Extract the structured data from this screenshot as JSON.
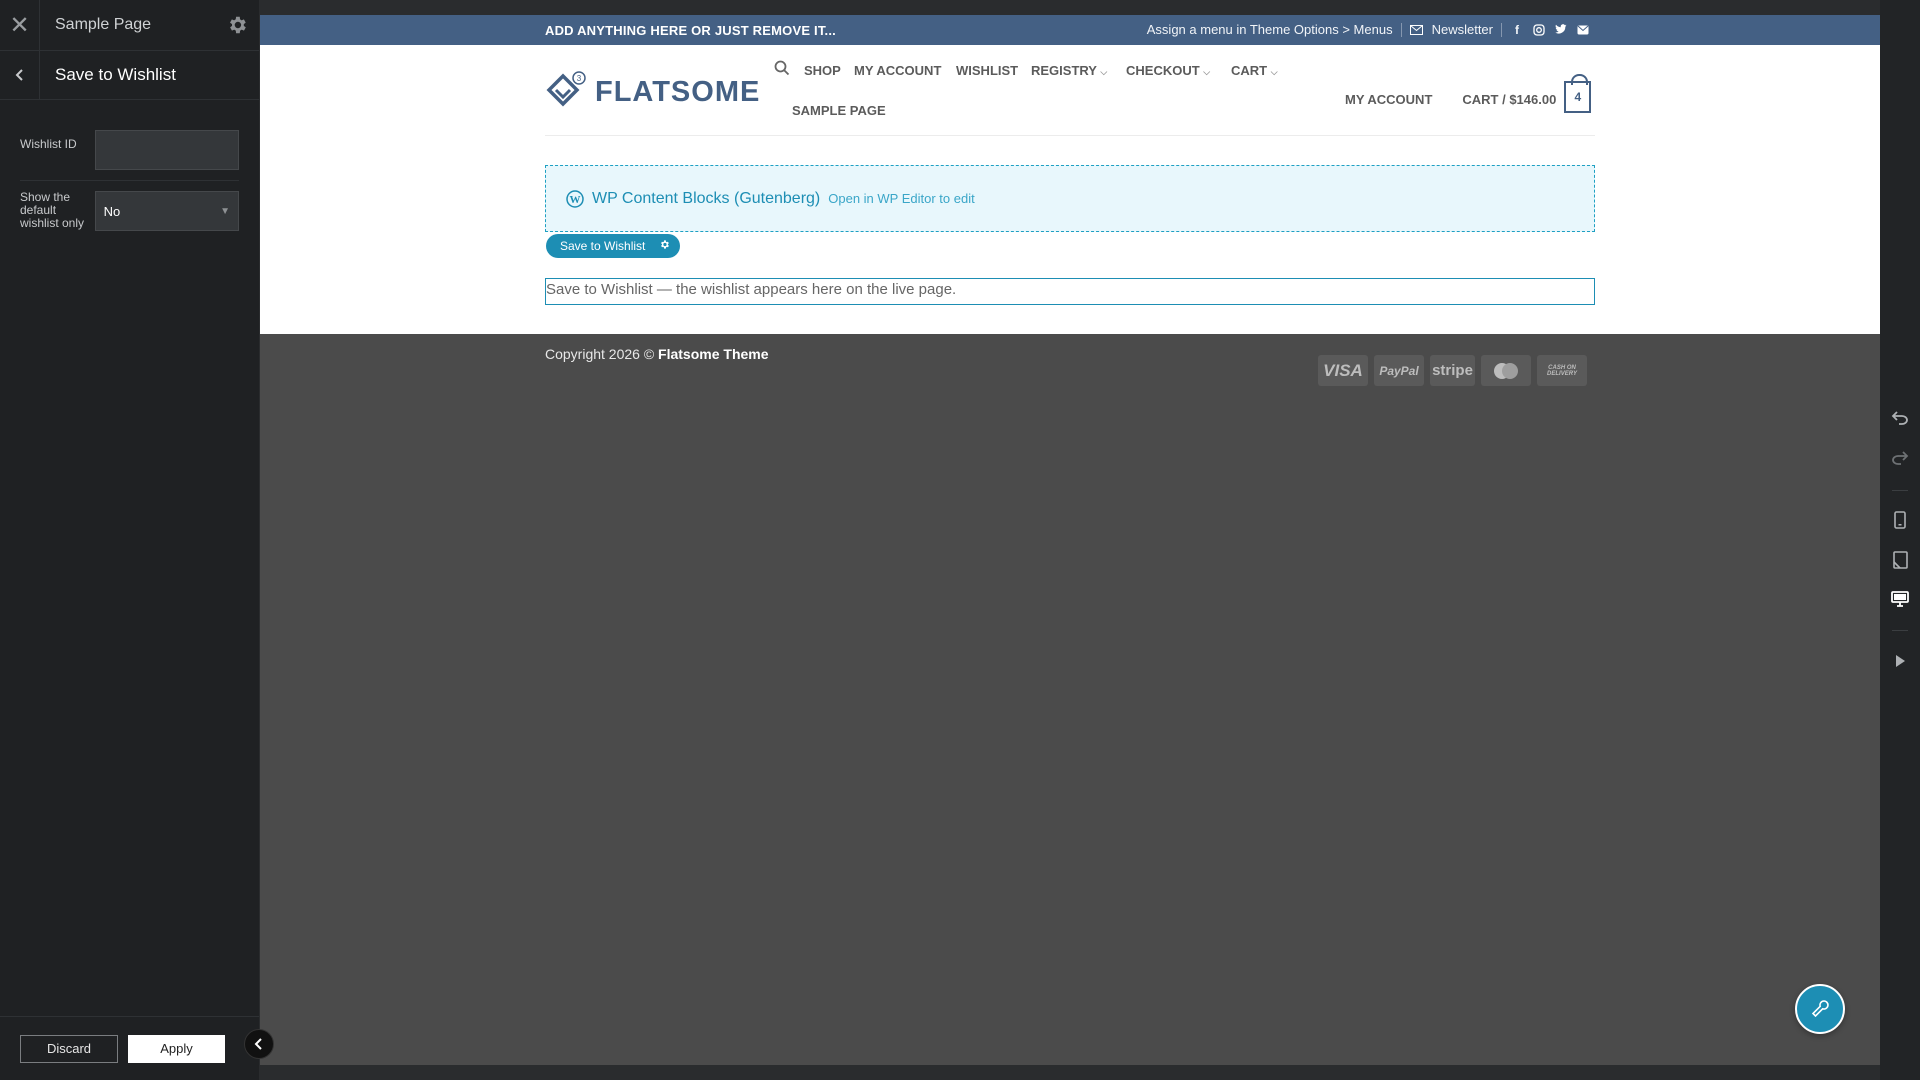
{
  "sidebar": {
    "page_name": "Sample Page",
    "panel_title": "Save to Wishlist",
    "fields": {
      "wishlist_id_label": "Wishlist ID",
      "wishlist_id_value": "",
      "default_only_label": "Show the default wishlist only",
      "default_only_value": "No"
    },
    "discard_label": "Discard",
    "apply_label": "Apply"
  },
  "site": {
    "topbar_left": "ADD ANYTHING HERE OR JUST REMOVE IT...",
    "topbar_menu_hint": "Assign a menu in Theme Options > Menus",
    "newsletter_label": "Newsletter",
    "logo_text": "FLATSOME",
    "nav": [
      "SHOP",
      "MY ACCOUNT",
      "WISHLIST",
      "REGISTRY",
      "CHECKOUT",
      "CART",
      "SAMPLE PAGE"
    ],
    "account_label": "MY ACCOUNT",
    "cart_label": "CART / $146.00",
    "cart_count": "4",
    "wp_block_title": "WP Content Blocks (Gutenberg)",
    "wp_block_link": "Open in WP Editor to edit",
    "wishlist_tag": "Save to Wishlist",
    "wishlist_text": "Save to Wishlist — the wishlist appears here on the live page.",
    "footer_copy_prefix": "Copyright 2026 © ",
    "footer_copy_brand": "Flatsome Theme",
    "payments": [
      "VISA",
      "PayPal",
      "stripe",
      "mastercard",
      "CASH ON DELIVERY"
    ]
  },
  "colors": {
    "primary": "#446084",
    "accent": "#1d8eb4",
    "sidebar_bg": "#1f2123"
  },
  "icons": {
    "close": "close-icon",
    "settings": "gear-icon",
    "back": "chevron-left-icon",
    "undo": "undo-icon",
    "redo": "redo-icon",
    "mobile": "mobile-icon",
    "tablet": "tablet-icon",
    "desktop": "desktop-icon",
    "play": "play-icon",
    "search": "search-icon",
    "wrench": "wrench-icon"
  }
}
